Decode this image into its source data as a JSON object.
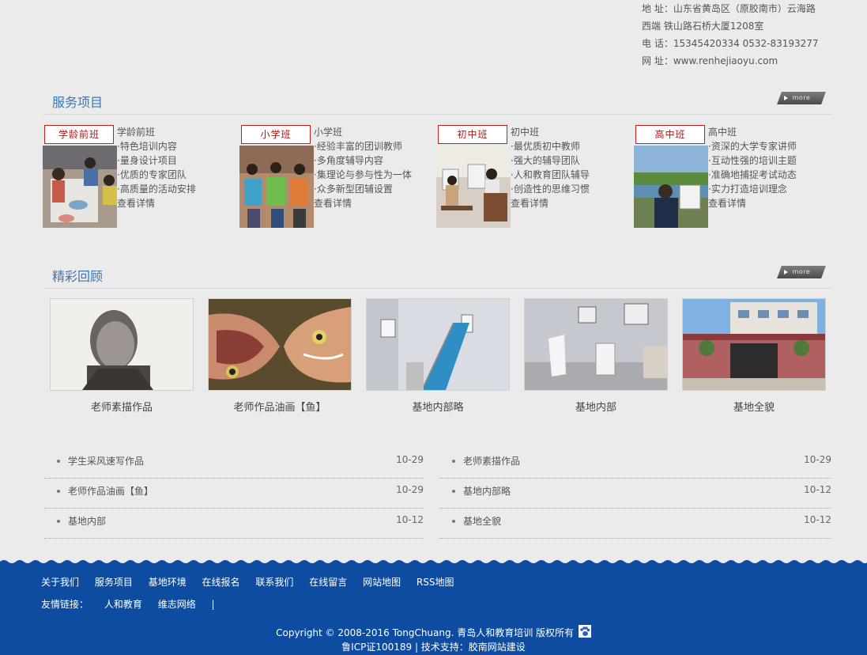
{
  "contact": {
    "address_line1": "地 址：山东省黄岛区（原胶南市）云海路",
    "address_line2": "西端 铁山路石桥大厦1208室",
    "phone": "电 话：15345420334 0532-83193277",
    "website": "网 址：www.renhejiaoyu.com"
  },
  "services": {
    "title": "服务项目",
    "more": "more",
    "courses": [
      {
        "tag": "学龄前班",
        "name": "学龄前班",
        "points": [
          "特色培训内容",
          "量身设计项目",
          "优质的专家团队",
          "高质量的活动安排"
        ],
        "detail": "查看详情"
      },
      {
        "tag": "小学班",
        "name": "小学班",
        "points": [
          "经验丰富的团训教师",
          "多角度辅导内容",
          "集理论与参与性为一体",
          "众多新型团辅设置"
        ],
        "detail": "查看详情"
      },
      {
        "tag": "初中班",
        "name": "初中班",
        "points": [
          "最优质初中教师",
          "强大的辅导团队",
          "人和教育团队辅导",
          "创造性的思维习惯"
        ],
        "detail": "查看详情"
      },
      {
        "tag": "高中班",
        "name": "高中班",
        "points": [
          "资深的大学专家讲师",
          "互动性强的培训主题",
          "准确地捕捉考试动态",
          "实力打造培训理念"
        ],
        "detail": "查看详情"
      }
    ]
  },
  "review": {
    "title": "精彩回顾",
    "more": "more",
    "items": [
      {
        "caption": "老师素描作品"
      },
      {
        "caption": "老师作品油画【鱼】"
      },
      {
        "caption": "基地内部略"
      },
      {
        "caption": "基地内部"
      },
      {
        "caption": "基地全貌"
      }
    ]
  },
  "news": {
    "left": [
      {
        "title": "学生采风速写作品",
        "date": "10-29"
      },
      {
        "title": "老师作品油画【鱼】",
        "date": "10-29"
      },
      {
        "title": "基地内部",
        "date": "10-12"
      }
    ],
    "right": [
      {
        "title": "老师素描作品",
        "date": "10-29"
      },
      {
        "title": "基地内部略",
        "date": "10-12"
      },
      {
        "title": "基地全貌",
        "date": "10-12"
      }
    ]
  },
  "footer": {
    "nav": [
      "关于我们",
      "服务项目",
      "基地环境",
      "在线报名",
      "联系我们",
      "在线留言",
      "网站地图",
      "RSS地图"
    ],
    "links_label": "友情链接：",
    "links": [
      "人和教育",
      "维志网络",
      "|"
    ],
    "copyright": "Copyright © 2008-2016 TongChuang. 青岛人和教育培训 版权所有",
    "icp": "鲁ICP证100189 | 技术支持：胶南网站建设"
  },
  "colors": {
    "accent": "#3b76b5",
    "footer_bg": "#0d4ca1",
    "tag_border": "#c41e1e"
  }
}
